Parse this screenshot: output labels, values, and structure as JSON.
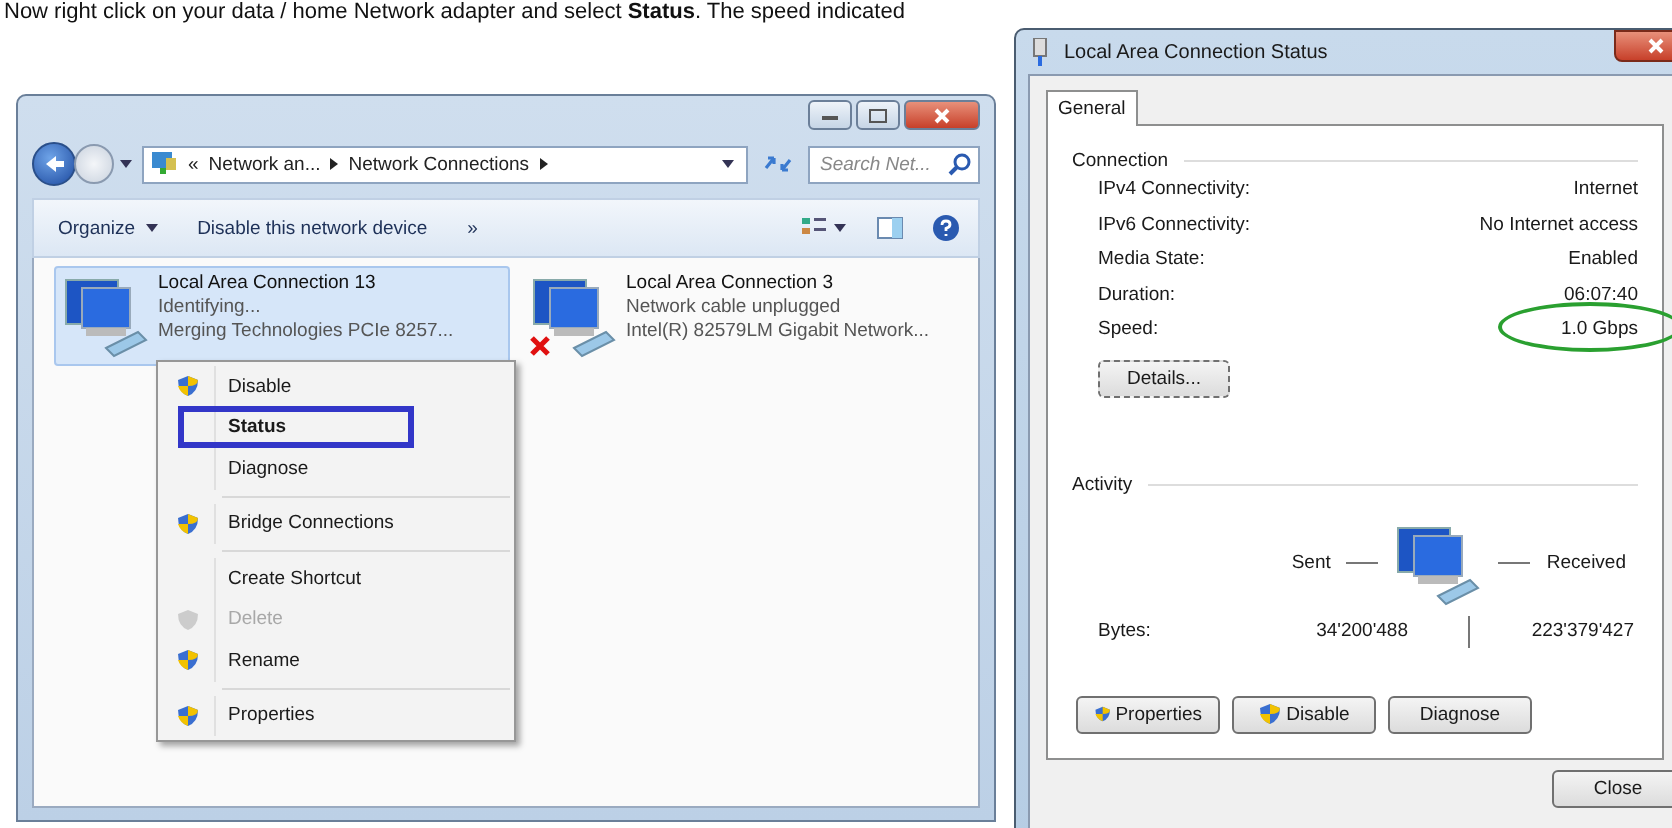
{
  "caption": "Now right click on your data / home Network adapter and select **Status**. The speed indicated",
  "explorer": {
    "overflow": "«",
    "breadcrumb": [
      "Network an...",
      "Network Connections"
    ],
    "search": {
      "placeholder": "Search Net..."
    },
    "toolbar": [
      {
        "label": "Organize",
        "dropdown": true
      },
      {
        "label": "Disable this network device",
        "dropdown": false
      },
      {
        "label": "»",
        "dropdown": false
      }
    ],
    "connections": [
      {
        "name": "Local Area Connection 13",
        "status": "Identifying...",
        "adapter": "Merging Technologies PCIe 8257...",
        "selected": true,
        "unplugged": false
      },
      {
        "name": "Local Area Connection 3",
        "status": "Network cable unplugged",
        "adapter": "Intel(R) 82579LM Gigabit Network...",
        "selected": false,
        "unplugged": true
      }
    ]
  },
  "context_menu": [
    [
      {
        "label": "Disable",
        "shield": true,
        "disabled": false,
        "default": false,
        "highlighted": false
      },
      {
        "label": "Status",
        "shield": false,
        "disabled": false,
        "default": true,
        "highlighted": true
      },
      {
        "label": "Diagnose",
        "shield": false,
        "disabled": false,
        "default": false,
        "highlighted": false
      }
    ],
    [
      {
        "label": "Bridge Connections",
        "shield": true,
        "disabled": false,
        "default": false,
        "highlighted": false
      }
    ],
    [
      {
        "label": "Create Shortcut",
        "shield": false,
        "disabled": false,
        "default": false,
        "highlighted": false
      },
      {
        "label": "Delete",
        "shield": true,
        "disabled": true,
        "default": false,
        "highlighted": false
      },
      {
        "label": "Rename",
        "shield": true,
        "disabled": false,
        "default": false,
        "highlighted": false
      }
    ],
    [
      {
        "label": "Properties",
        "shield": true,
        "disabled": false,
        "default": false,
        "highlighted": false
      }
    ]
  ],
  "dialog": {
    "title": "Local Area Connection Status",
    "tabs": [
      {
        "label": "General",
        "selected": true
      }
    ],
    "connection_heading": "Connection",
    "rows": [
      {
        "label": "IPv4 Connectivity:",
        "value": "Internet",
        "circled": false
      },
      {
        "label": "IPv6 Connectivity:",
        "value": "No Internet access",
        "circled": false
      },
      {
        "label": "Media State:",
        "value": "Enabled",
        "circled": false
      },
      {
        "label": "Duration:",
        "value": "06:07:40",
        "circled": false
      },
      {
        "label": "Speed:",
        "value": "1.0 Gbps",
        "circled": true
      }
    ],
    "details_button": "Details...",
    "activity_heading": "Activity",
    "sent": "Sent",
    "received": "Received",
    "bytes_label": "Bytes:",
    "bytes_sent": "34'200'488",
    "bytes_received": "223'379'427",
    "buttons": [
      {
        "label": "Properties",
        "shield": true
      },
      {
        "label": "Disable",
        "shield": true
      },
      {
        "label": "Diagnose",
        "shield": false
      }
    ],
    "close": "Close"
  }
}
